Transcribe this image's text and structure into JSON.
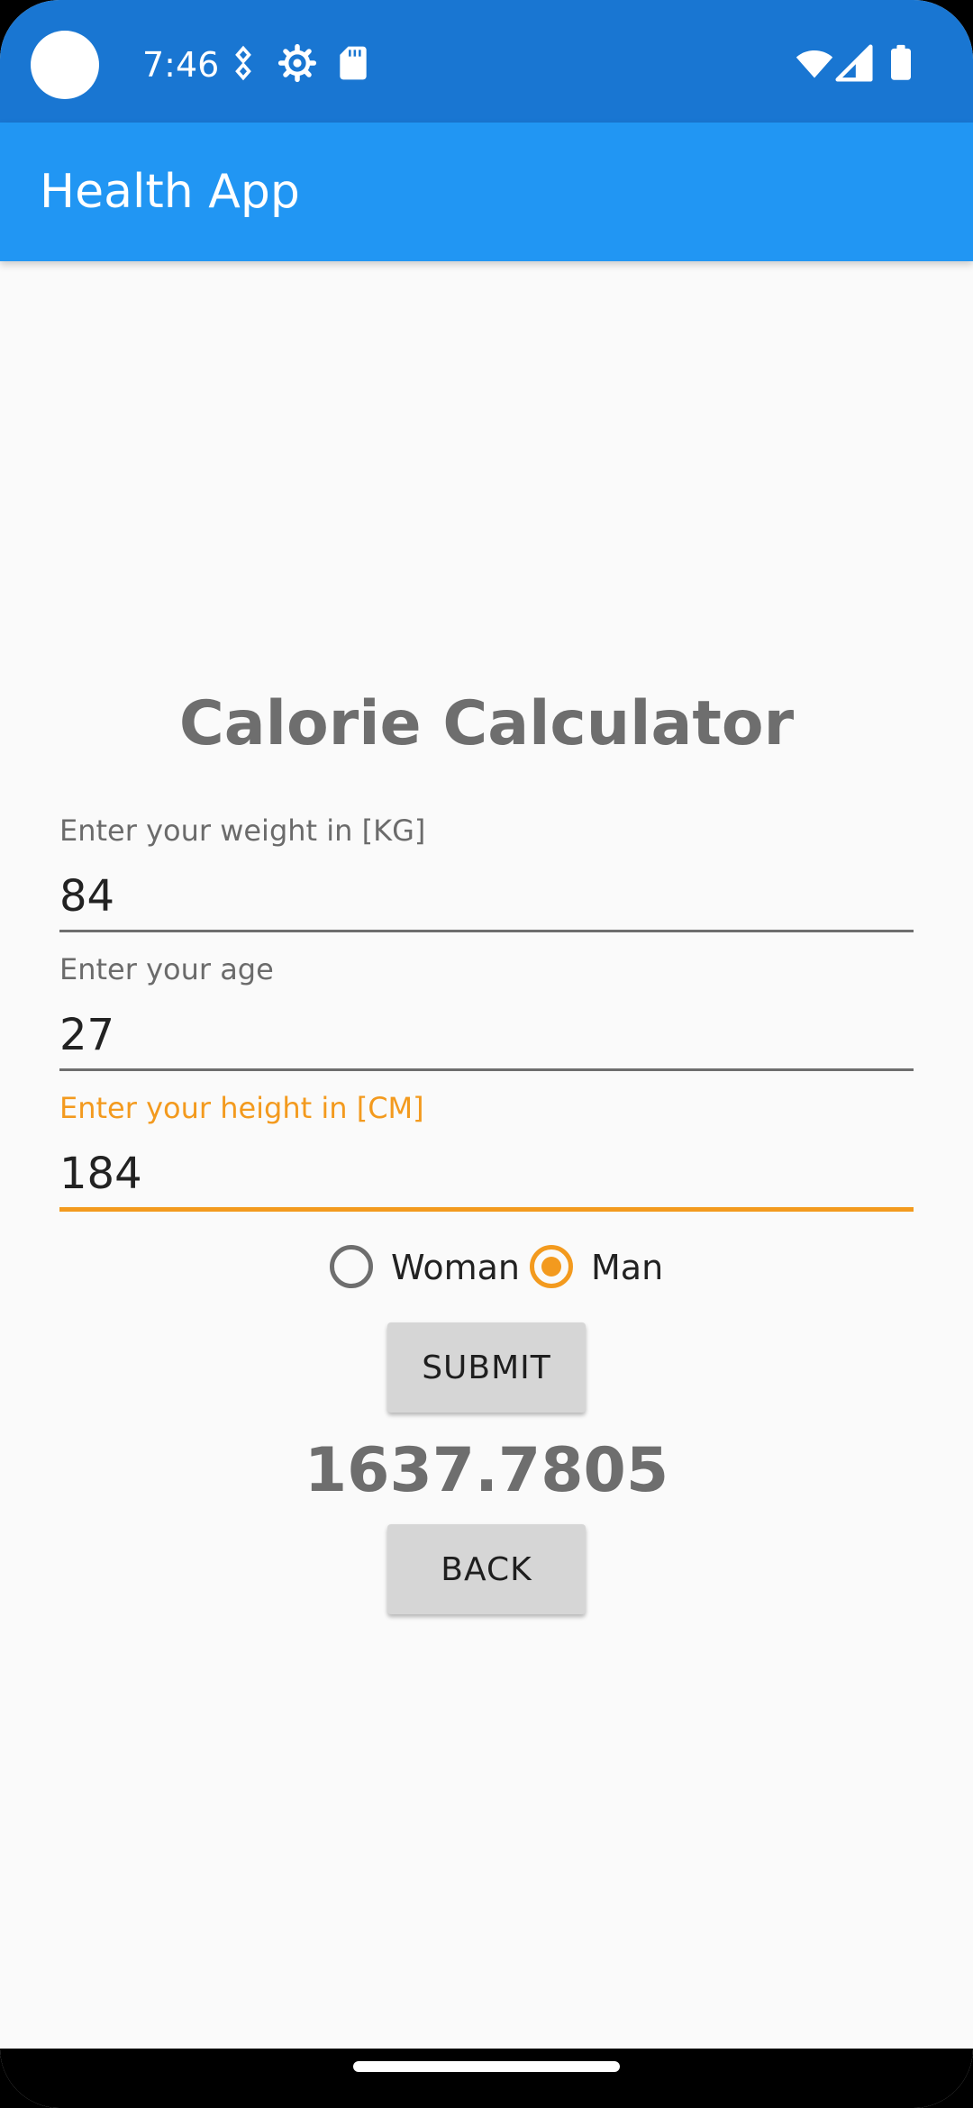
{
  "status_bar": {
    "time": "7:46",
    "icons": [
      "camera-cutout",
      "nfc-icon",
      "settings-icon",
      "sd-card-icon",
      "wifi-icon",
      "signal-icon",
      "battery-icon"
    ]
  },
  "app_bar": {
    "title": "Health App"
  },
  "main": {
    "heading": "Calorie Calculator",
    "fields": [
      {
        "label": "Enter your weight in [KG]",
        "value": "84"
      },
      {
        "label": "Enter your age",
        "value": "27"
      },
      {
        "label": "Enter your height in [CM]",
        "value": "184"
      }
    ],
    "gender": {
      "options": [
        "Woman",
        "Man"
      ],
      "selected": "Man"
    },
    "submit_label": "SUBMIT",
    "result": "1637.7805",
    "back_label": "BACK"
  },
  "colors": {
    "status_bar": "#1976D2",
    "app_bar": "#2196F3",
    "accent": "#F39A1E",
    "background": "#FAFAFA",
    "button": "#D6D6D6"
  }
}
